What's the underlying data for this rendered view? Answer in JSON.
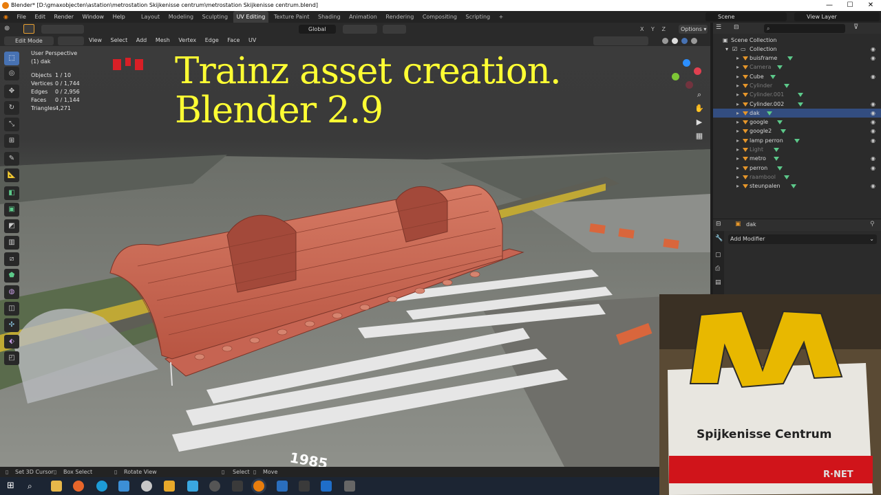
{
  "window": {
    "title": "Blender* [D:\\gmaxobjecten\\astation\\metrostation Skijkenisse centrum\\metrostation Skijkenisse centrum.blend]",
    "min": "—",
    "max": "☐",
    "close": "✕"
  },
  "menubar": {
    "menus": [
      "File",
      "Edit",
      "Render",
      "Window",
      "Help"
    ],
    "workspaces": [
      "Layout",
      "Modeling",
      "Sculpting",
      "UV Editing",
      "Texture Paint",
      "Shading",
      "Animation",
      "Rendering",
      "Compositing",
      "Scripting",
      "+"
    ],
    "active_workspace": "UV Editing",
    "scene": "Scene",
    "view_layer": "View Layer"
  },
  "toolrow": {
    "orientation": "Global",
    "options": "Options",
    "axes": [
      "X",
      "Y",
      "Z"
    ]
  },
  "header": {
    "mode": "Edit Mode",
    "menus": [
      "View",
      "Select",
      "Add",
      "Mesh",
      "Vertex",
      "Edge",
      "Face",
      "UV"
    ]
  },
  "viewport": {
    "view_name": "User Perspective",
    "object_name": "(1) dak",
    "stats": [
      {
        "label": "Objects",
        "value": "1 / 10"
      },
      {
        "label": "Vertices",
        "value": "0 / 1,744"
      },
      {
        "label": "Edges",
        "value": "0 / 2,956"
      },
      {
        "label": "Faces",
        "value": "0 / 1,144"
      },
      {
        "label": "Triangles",
        "value": "4,271"
      }
    ],
    "overlay_line1": "Trainz asset creation.",
    "overlay_line2": "Blender 2.9",
    "ground_text": "1985",
    "gizmo": {
      "x": "X",
      "y": "Y",
      "z": "Z"
    }
  },
  "outliner": {
    "search_placeholder": "",
    "root": "Scene Collection",
    "collection": "Collection",
    "items": [
      {
        "name": "buisframe",
        "dim": false,
        "selected": false
      },
      {
        "name": "Camera",
        "dim": true,
        "selected": false
      },
      {
        "name": "Cube",
        "dim": false,
        "selected": false
      },
      {
        "name": "Cylinder",
        "dim": true,
        "selected": false
      },
      {
        "name": "Cylinder.001",
        "dim": true,
        "selected": false
      },
      {
        "name": "Cylinder.002",
        "dim": false,
        "selected": false
      },
      {
        "name": "dak",
        "dim": false,
        "selected": true
      },
      {
        "name": "google",
        "dim": false,
        "selected": false
      },
      {
        "name": "google2",
        "dim": false,
        "selected": false
      },
      {
        "name": "lamp perron",
        "dim": false,
        "selected": false
      },
      {
        "name": "Light",
        "dim": true,
        "selected": false
      },
      {
        "name": "metro",
        "dim": false,
        "selected": false
      },
      {
        "name": "perron",
        "dim": false,
        "selected": false
      },
      {
        "name": "raambool",
        "dim": true,
        "selected": false
      },
      {
        "name": "steunpalen",
        "dim": false,
        "selected": false
      }
    ]
  },
  "properties": {
    "object": "dak",
    "add_modifier": "Add Modifier"
  },
  "inset": {
    "sign_text": "Spijkenisse Centrum",
    "brand": "R·NET",
    "logo_letter": "M"
  },
  "statusbar": {
    "items": [
      "Set 3D Cursor",
      "Box Select",
      "Rotate View",
      "Select",
      "Move"
    ]
  },
  "colors": {
    "accent": "#4772b3",
    "overlay_text": "#ffff33",
    "roof": "#c9654f",
    "sign_yellow": "#e8b800"
  }
}
